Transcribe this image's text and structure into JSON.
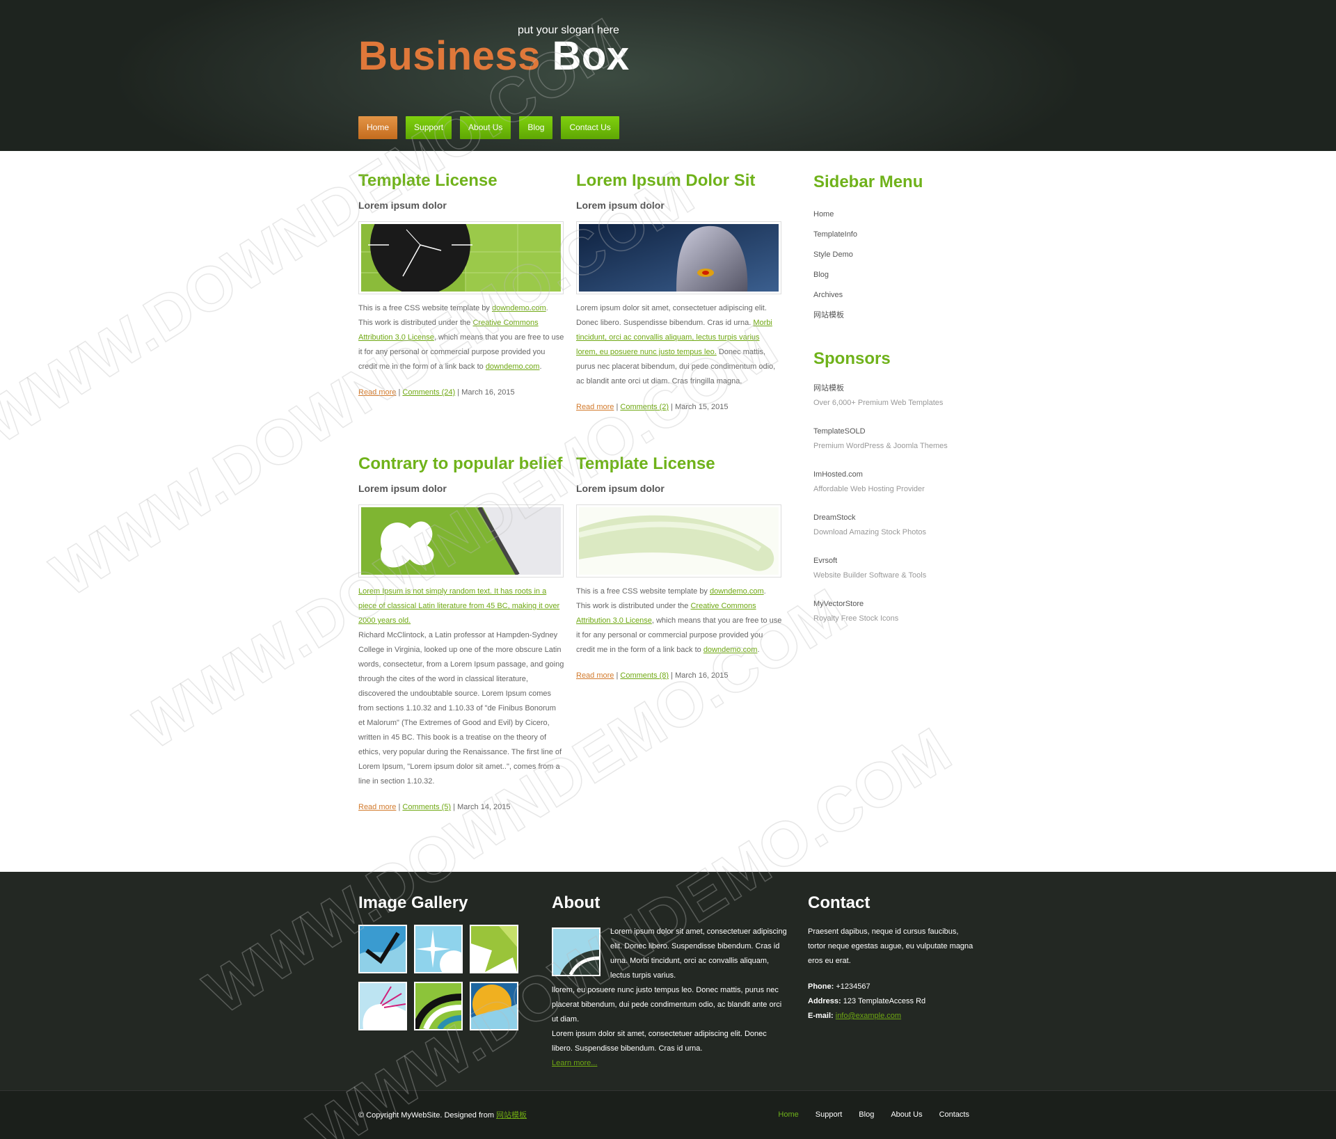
{
  "header": {
    "logo_part1": "Business",
    "logo_part2": "Box",
    "slogan": "put your slogan here"
  },
  "nav": [
    {
      "label": "Home"
    },
    {
      "label": "Support"
    },
    {
      "label": "About Us"
    },
    {
      "label": "Blog"
    },
    {
      "label": "Contact Us"
    }
  ],
  "posts": [
    {
      "title": "Template License",
      "subtitle": "Lorem ipsum dolor",
      "body_html": "This is a free CSS website template by <a>downdemo.com</a>. This work is distributed under the <a>Creative Commons Attribution 3.0 License</a>, which means that you are free to use it for any personal or commercial purpose provided you credit me in the form of a link back to <a>downdemo.com</a>.",
      "read_more": "Read more",
      "comments": "Comments (24)",
      "date": "March 16, 2015"
    },
    {
      "title": "Lorem Ipsum Dolor Sit",
      "subtitle": "Lorem ipsum dolor",
      "body_html": "Lorem ipsum dolor sit amet, consectetuer adipiscing elit. Donec libero. Suspendisse bibendum. Cras id urna. <a>Morbi tincidunt, orci ac convallis aliquam, lectus turpis varius lorem, eu posuere nunc justo tempus leo.</a> Donec mattis, purus nec placerat bibendum, dui pede condimentum odio, ac blandit ante orci ut diam. Cras fringilla magna.",
      "read_more": "Read more",
      "comments": "Comments (2)",
      "date": "March 15, 2015"
    },
    {
      "title": "Contrary to popular belief",
      "subtitle": "Lorem ipsum dolor",
      "body_html": "<a>Lorem Ipsum is not simply random text. It has roots in a piece of classical Latin literature from 45 BC, making it over 2000 years old.</a><br>Richard McClintock, a Latin professor at Hampden-Sydney College in Virginia, looked up one of the more obscure Latin words, consectetur, from a Lorem Ipsum passage, and going through the cites of the word in classical literature, discovered the undoubtable source. Lorem Ipsum comes from sections 1.10.32 and 1.10.33 of \"de Finibus Bonorum et Malorum\" (The Extremes of Good and Evil) by Cicero, written in 45 BC. This book is a treatise on the theory of ethics, very popular during the Renaissance. The first line of Lorem Ipsum, \"Lorem ipsum dolor sit amet..\", comes from a line in section 1.10.32.",
      "read_more": "Read more",
      "comments": "Comments (5)",
      "date": "March 14, 2015"
    },
    {
      "title": "Template License",
      "subtitle": "Lorem ipsum dolor",
      "body_html": "This is a free CSS website template by <a>downdemo.com</a>. This work is distributed under the <a>Creative Commons Attribution 3.0 License</a>, which means that you are free to use it for any personal or commercial purpose provided you credit me in the form of a link back to <a>downdemo.com</a>.",
      "read_more": "Read more",
      "comments": "Comments (8)",
      "date": "March 16, 2015"
    }
  ],
  "sidebar": {
    "menu_title": "Sidebar Menu",
    "menu": [
      "Home",
      "TemplateInfo",
      "Style Demo",
      "Blog",
      "Archives",
      "网站模板"
    ],
    "sponsors_title": "Sponsors",
    "sponsors": [
      {
        "name": "网站模板",
        "desc": "Over 6,000+ Premium Web Templates"
      },
      {
        "name": "TemplateSOLD",
        "desc": "Premium WordPress & Joomla Themes"
      },
      {
        "name": "ImHosted.com",
        "desc": "Affordable Web Hosting Provider"
      },
      {
        "name": "DreamStock",
        "desc": "Download Amazing Stock Photos"
      },
      {
        "name": "Evrsoft",
        "desc": "Website Builder Software & Tools"
      },
      {
        "name": "MyVectorStore",
        "desc": "Royalty Free Stock Icons"
      }
    ]
  },
  "footer": {
    "gallery_title": "Image Gallery",
    "about_title": "About",
    "about_text1": "Lorem ipsum dolor sit amet, consectetuer adipiscing elit. Donec libero. Suspendisse bibendum. Cras id urna. Morbi tincidunt, orci ac convallis aliquam, lectus turpis varius.",
    "about_text2": "llorem, eu posuere nunc justo tempus leo. Donec mattis, purus nec placerat bibendum, dui pede condimentum odio, ac blandit ante orci ut diam.",
    "about_text3": "Lorem ipsum dolor sit amet, consectetuer adipiscing elit. Donec libero. Suspendisse bibendum. Cras id urna.",
    "learn_more": "Learn more...",
    "contact_title": "Contact",
    "contact_text": "Praesent dapibus, neque id cursus faucibus, tortor neque egestas augue, eu vulputate magna eros eu erat.",
    "phone_label": "Phone:",
    "phone": "+1234567",
    "address_label": "Address:",
    "address": "123 TemplateAccess Rd",
    "email_label": "E-mail:",
    "email": "info@example.com"
  },
  "bottom": {
    "copyright": "© Copyright MyWebSite. Designed from ",
    "designer_link": "网站模板",
    "nav": [
      {
        "label": "Home"
      },
      {
        "label": "Support"
      },
      {
        "label": "Blog"
      },
      {
        "label": "About Us"
      },
      {
        "label": "Contacts"
      }
    ]
  },
  "watermark": "WWW.DOWNDEMO.COM",
  "colors": {
    "accent_green": "#6fb21a",
    "accent_orange": "#e0783a",
    "header_bg": "#2b342e",
    "footer_bg": "#232823"
  }
}
